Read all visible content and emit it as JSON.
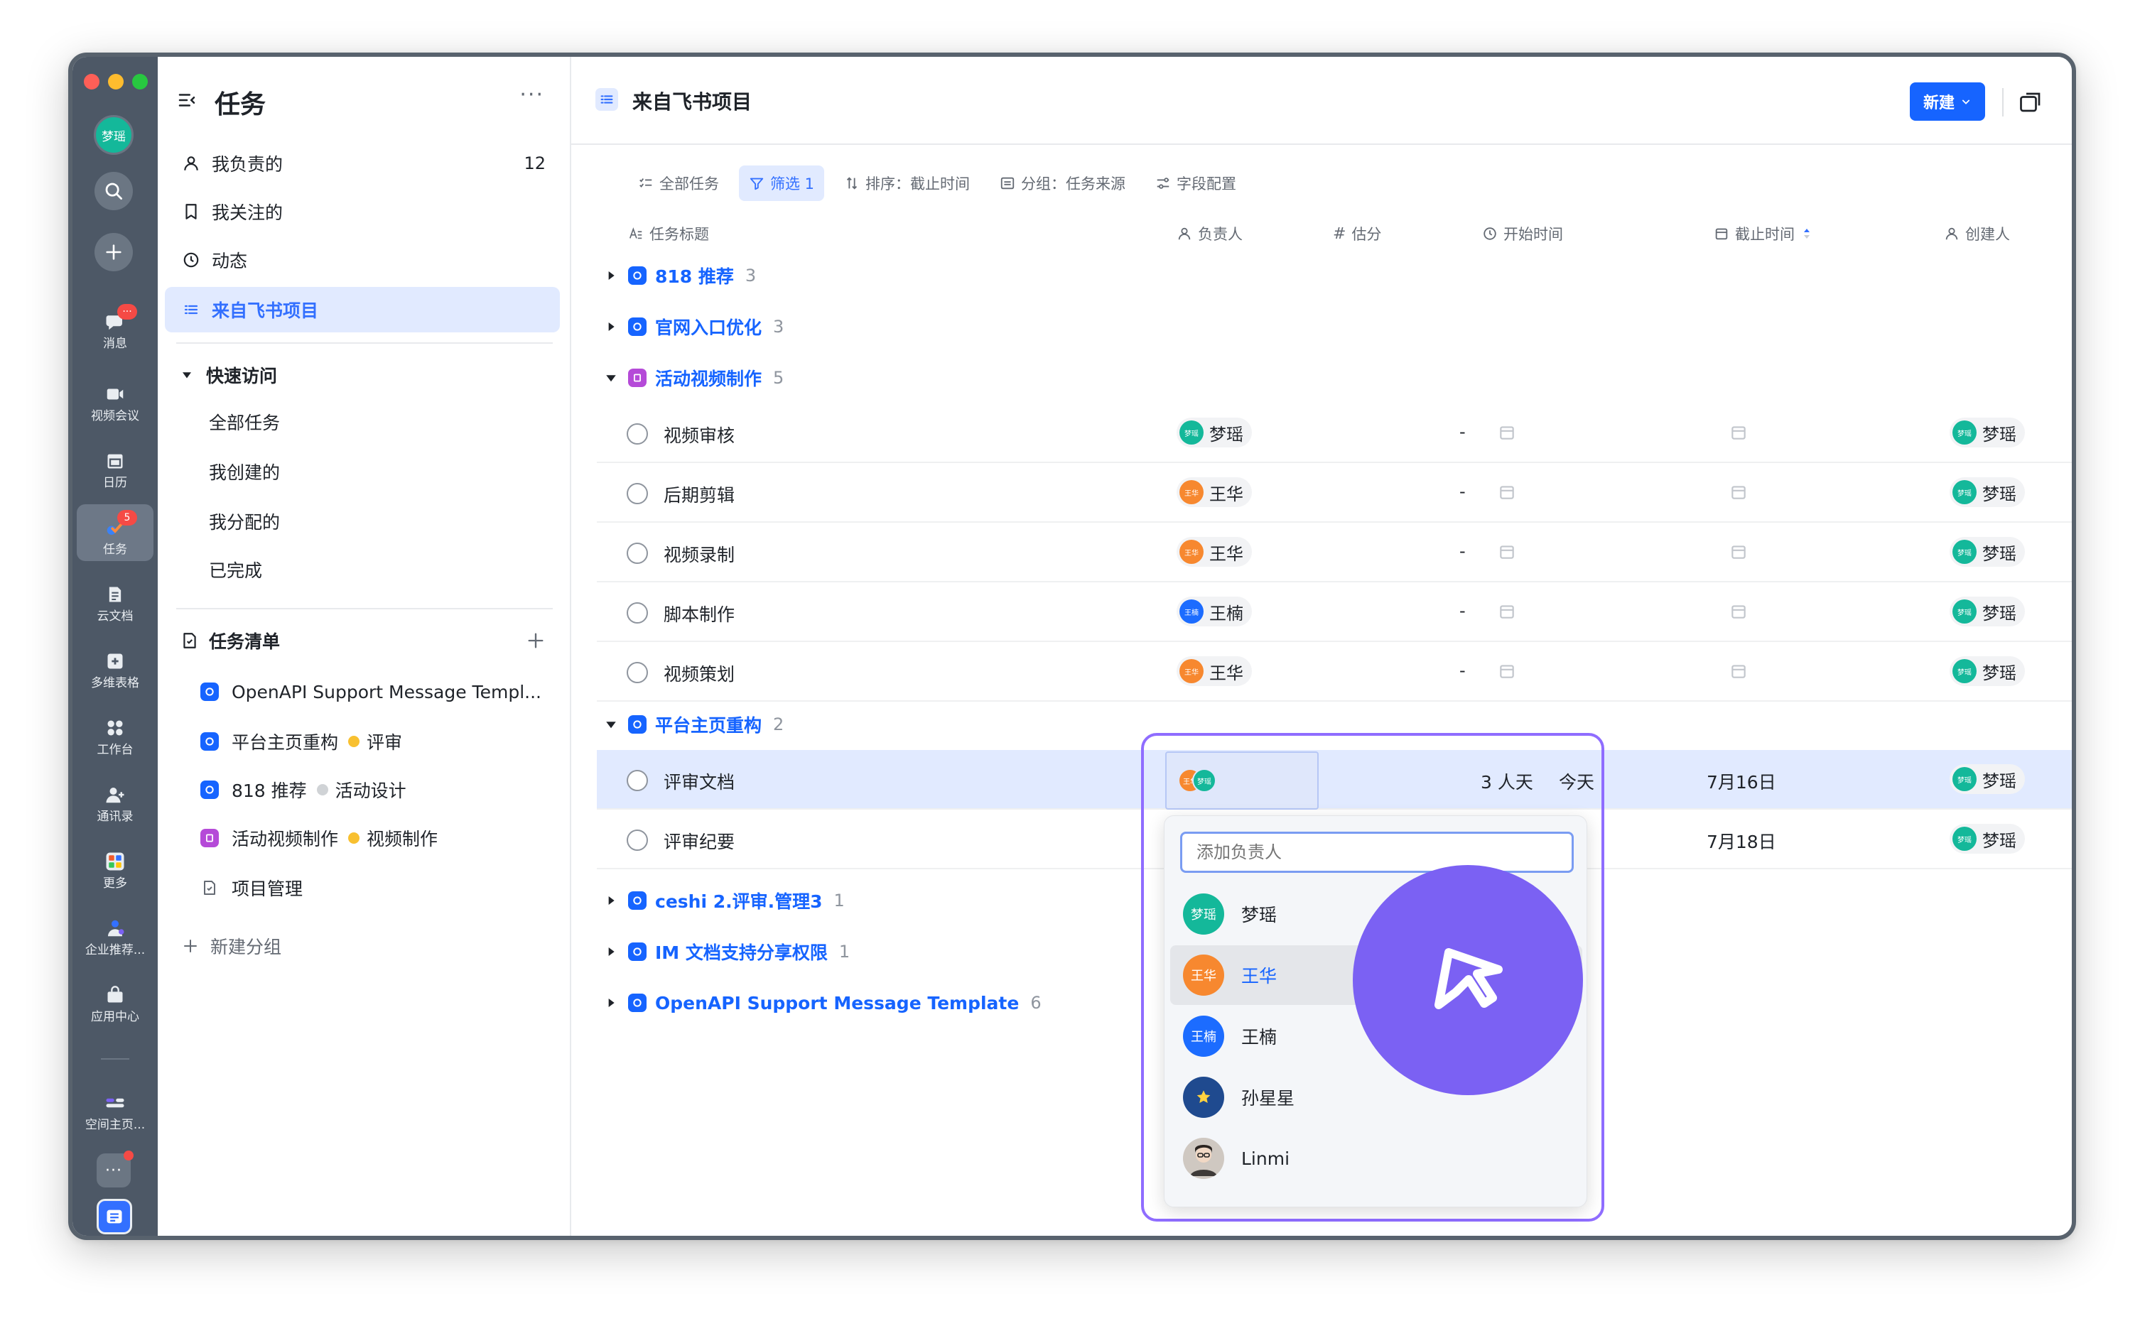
{
  "window": {
    "rail": {
      "avatar_text": "梦瑶",
      "items": [
        {
          "label": "消息",
          "icon": "chat-bubble-icon",
          "badge": "···"
        },
        {
          "label": "视频会议",
          "icon": "video-camera-icon"
        },
        {
          "label": "日历",
          "icon": "calendar-icon"
        },
        {
          "label": "任务",
          "icon": "task-icon",
          "badge": "5"
        },
        {
          "label": "云文档",
          "icon": "document-icon"
        },
        {
          "label": "多维表格",
          "icon": "base-table-icon"
        },
        {
          "label": "工作台",
          "icon": "workplace-icon"
        },
        {
          "label": "通讯录",
          "icon": "contacts-icon"
        },
        {
          "label": "更多",
          "icon": "more-apps-icon"
        },
        {
          "label": "企业推荐...",
          "icon": "enterprise-icon"
        },
        {
          "label": "应用中心",
          "icon": "app-center-icon"
        },
        {
          "label": "空间主页...",
          "icon": "space-home-icon"
        }
      ]
    },
    "sidebar": {
      "title": "任务",
      "more": "···",
      "nav": [
        {
          "label": "我负责的",
          "count": "12",
          "icon": "person-icon"
        },
        {
          "label": "我关注的",
          "icon": "bookmark-icon"
        },
        {
          "label": "动态",
          "icon": "clock-icon"
        },
        {
          "label": "来自飞书项目",
          "icon": "list-icon"
        }
      ],
      "quick_access": {
        "title": "快速访问",
        "items": [
          "全部任务",
          "我创建的",
          "我分配的",
          "已完成"
        ]
      },
      "task_lists": {
        "title": "任务清单",
        "items": [
          {
            "label": "OpenAPI Support Message Templ...",
            "color": "#1664ff"
          },
          {
            "label": "平台主页重构",
            "tag": "评审",
            "tag_color": "#f8c030",
            "color": "#1664ff"
          },
          {
            "label": "818 推荐",
            "tag": "活动设计",
            "tag_color": "#d0d3d6",
            "color": "#1664ff"
          },
          {
            "label": "活动视频制作",
            "tag": "视频制作",
            "tag_color": "#f8c030",
            "color": "#b54ad8"
          },
          {
            "label": "项目管理",
            "color": "#ffffff"
          }
        ],
        "new_group": "新建分组"
      }
    },
    "main": {
      "title": "来自飞书项目",
      "new_button": "新建",
      "toolbar": {
        "all_tasks": "全部任务",
        "filter": "筛选 1",
        "sort": "排序：截止时间",
        "group": "分组：任务来源",
        "fields": "字段配置"
      },
      "columns": {
        "title": "任务标题",
        "assignee": "负责人",
        "estimate": "估分",
        "start": "开始时间",
        "due": "截止时间",
        "creator": "创建人"
      },
      "groups": [
        {
          "name": "818 推荐",
          "count": "3",
          "color": "#1664ff"
        },
        {
          "name": "官网入口优化",
          "count": "3",
          "color": "#1664ff"
        },
        {
          "name": "活动视频制作",
          "count": "5",
          "color": "#b54ad8"
        },
        {
          "name": "平台主页重构",
          "count": "2",
          "color": "#1664ff"
        },
        {
          "name": "ceshi 2.评审.管理3",
          "count": "1",
          "color": "#1664ff"
        },
        {
          "name": "IM 文档支持分享权限",
          "count": "1",
          "color": "#1664ff"
        },
        {
          "name": "OpenAPI Support Message Template",
          "count": "6",
          "color": "#1664ff"
        }
      ],
      "video_tasks": [
        {
          "title": "视频审核",
          "assignee": "梦瑶",
          "assignee_avatar": "梦瑶",
          "assignee_color": "#14b89a",
          "estimate": "-",
          "creator": "梦瑶"
        },
        {
          "title": "后期剪辑",
          "assignee": "王华",
          "assignee_avatar": "王华",
          "assignee_color": "#f7882f",
          "estimate": "-",
          "creator": "梦瑶"
        },
        {
          "title": "视频录制",
          "assignee": "王华",
          "assignee_avatar": "王华",
          "assignee_color": "#f7882f",
          "estimate": "-",
          "creator": "梦瑶"
        },
        {
          "title": "脚本制作",
          "assignee": "王楠",
          "assignee_avatar": "王楠",
          "assignee_color": "#1c6cff",
          "estimate": "-",
          "creator": "梦瑶"
        },
        {
          "title": "视频策划",
          "assignee": "王华",
          "assignee_avatar": "王华",
          "assignee_color": "#f7882f",
          "estimate": "-",
          "creator": "梦瑶"
        }
      ],
      "platform_tasks": [
        {
          "title": "评审文档",
          "estimate": "3 人天",
          "start": "今天",
          "due": "7月16日",
          "creator": "梦瑶",
          "avatars": [
            {
              "text": "王华",
              "color": "#f7882f"
            },
            {
              "text": "梦瑶",
              "color": "#14b89a"
            }
          ]
        },
        {
          "title": "评审纪要",
          "due": "7月18日",
          "creator": "梦瑶"
        }
      ],
      "assignee_dropdown": {
        "placeholder": "添加负责人",
        "options": [
          {
            "name": "梦瑶",
            "avatar": "梦瑶",
            "color": "#14b89a"
          },
          {
            "name": "王华",
            "avatar": "王华",
            "color": "#f7882f"
          },
          {
            "name": "王楠",
            "avatar": "王楠",
            "color": "#1c6cff"
          },
          {
            "name": "孙星星",
            "avatar": "star-avatar",
            "color": "#1f4a8f"
          },
          {
            "name": "Linmi",
            "avatar": "photo-avatar",
            "color": "#6b5a50"
          }
        ]
      }
    }
  }
}
